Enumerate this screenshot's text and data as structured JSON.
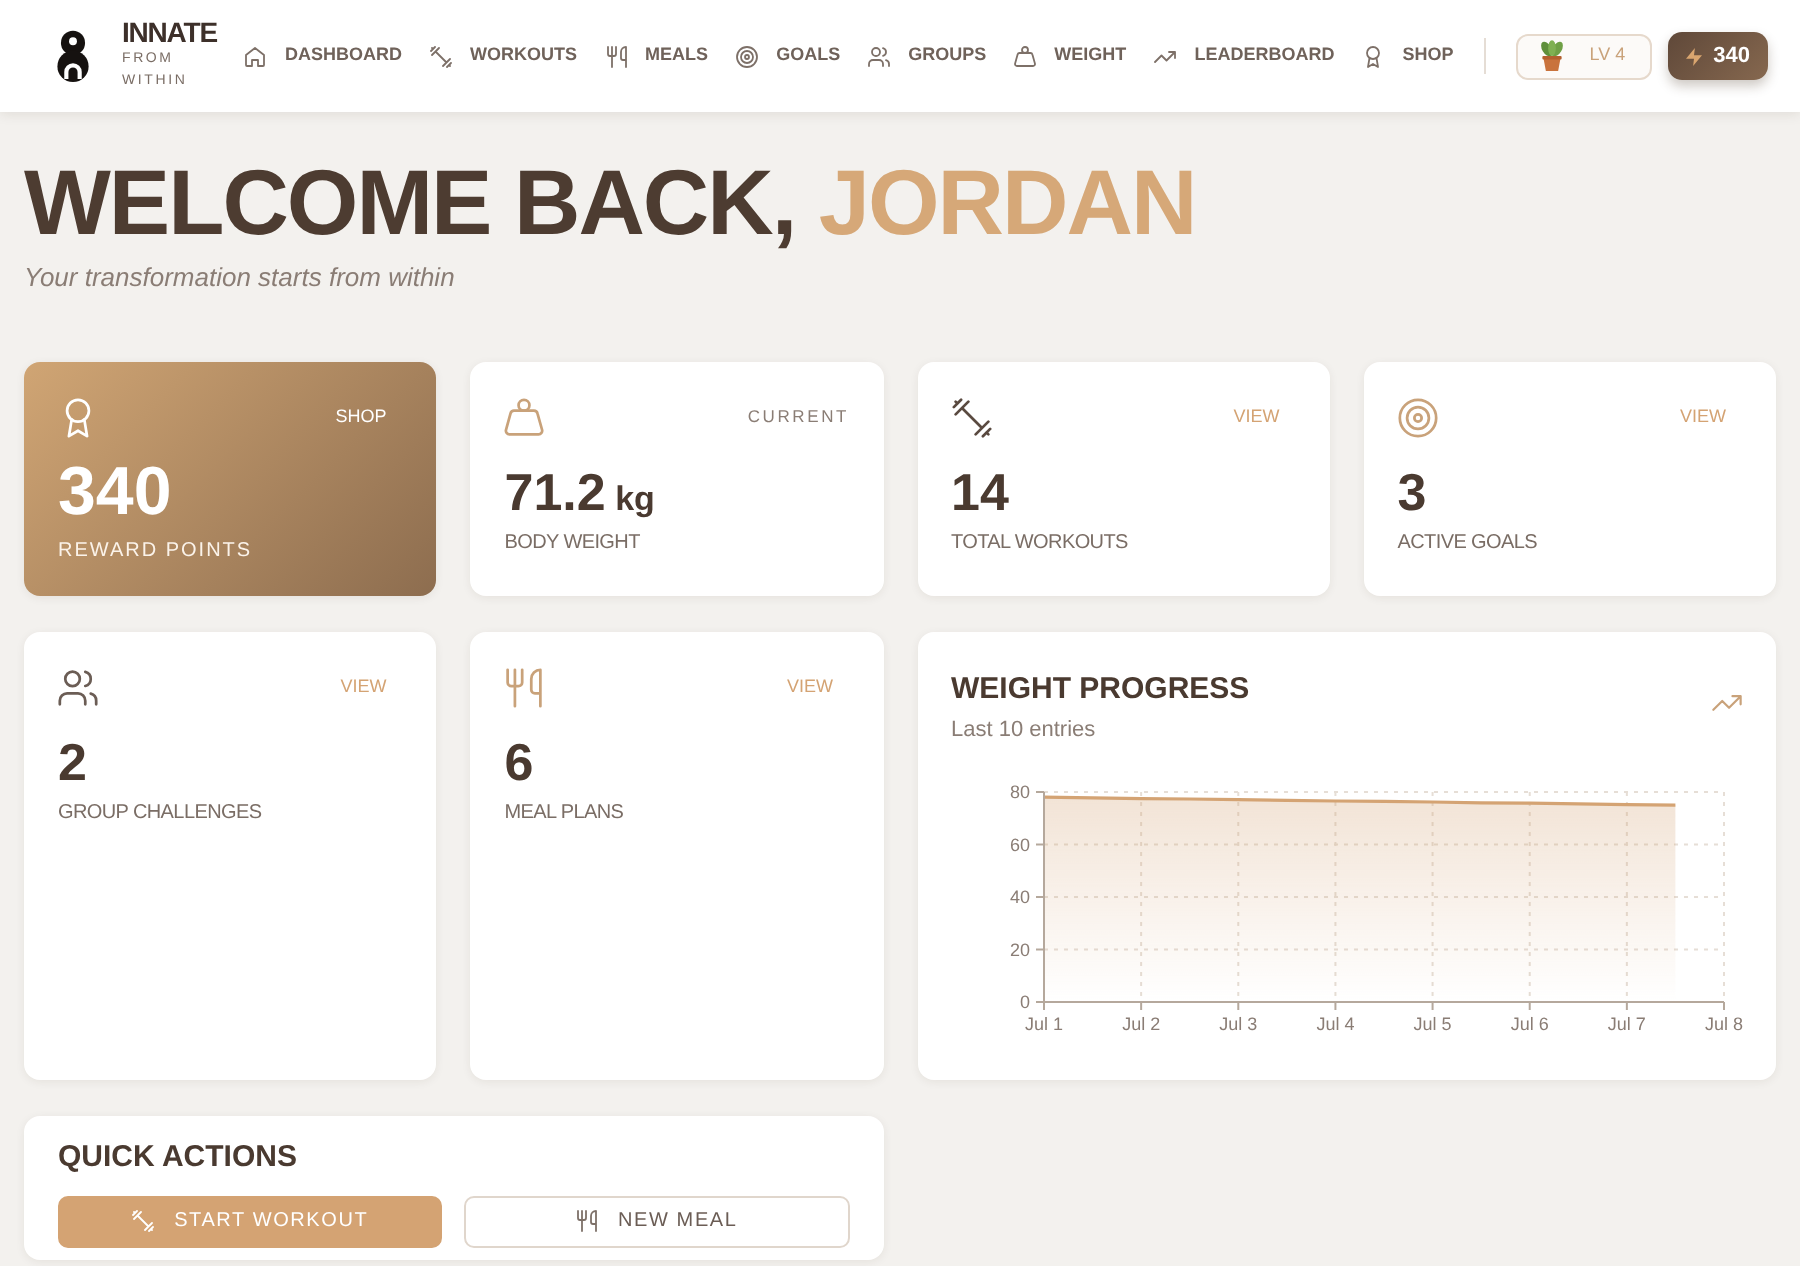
{
  "brand": {
    "name": "INNATE",
    "tagline": "FROM WITHIN"
  },
  "nav": [
    {
      "label": "DASHBOARD",
      "selected": false
    },
    {
      "label": "WORKOUTS",
      "selected": false
    },
    {
      "label": "MEALS",
      "selected": false
    },
    {
      "label": "GOALS",
      "selected": false
    },
    {
      "label": "GROUPS",
      "selected": false
    },
    {
      "label": "WEIGHT",
      "selected": false
    },
    {
      "label": "LEADERBOARD",
      "selected": false
    },
    {
      "label": "SHOP",
      "selected": false
    }
  ],
  "level_badge": "LV 4",
  "points_badge": "340",
  "header": {
    "greeting": "WELCOME BACK,",
    "name": "JORDAN",
    "subtitle": "Your transformation starts from within"
  },
  "stats": [
    {
      "kind": "featured",
      "action": "SHOP",
      "value": "340",
      "label": "REWARD POINTS"
    },
    {
      "kind": "plain",
      "caption": "CURRENT",
      "value": "71.2",
      "unit": "kg",
      "label": "BODY WEIGHT"
    },
    {
      "kind": "plain",
      "action": "VIEW",
      "value": "14",
      "label": "TOTAL WORKOUTS"
    },
    {
      "kind": "plain",
      "action": "VIEW",
      "value": "3",
      "label": "ACTIVE GOALS"
    },
    {
      "kind": "plain",
      "action": "VIEW",
      "value": "2",
      "label": "GROUP CHALLENGES"
    },
    {
      "kind": "plain",
      "action": "VIEW",
      "value": "6",
      "label": "MEAL PLANS"
    }
  ],
  "weight_progress": {
    "title": "WEIGHT PROGRESS",
    "subtitle": "Last 10 entries",
    "chart_data": {
      "type": "area",
      "grid": true,
      "categories": [
        "Jul 1",
        null,
        "Jul 2",
        null,
        "Jul 3",
        null,
        "Jul 4",
        null,
        "Jul 5",
        null,
        "Jul 6",
        null,
        "Jul 7",
        null,
        "Jul 8"
      ],
      "values": [
        78,
        77.8,
        77.5,
        77.3,
        77.1,
        76.8,
        76.6,
        76.4,
        76.2,
        75.9,
        75.7,
        75.5,
        75.2,
        75,
        null
      ],
      "ylim": [
        0,
        80
      ],
      "yticks": [
        0,
        20,
        40,
        60,
        80
      ]
    }
  },
  "quick_actions": {
    "title": "QUICK ACTIONS",
    "buttons": [
      {
        "kind": "primary",
        "label": "START WORKOUT"
      },
      {
        "kind": "outline",
        "label": "NEW MEAL"
      }
    ]
  }
}
